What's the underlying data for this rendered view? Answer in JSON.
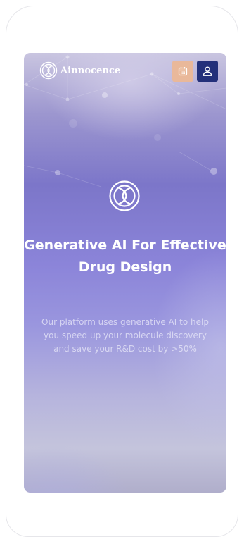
{
  "header": {
    "brand_name": "Ainnocence",
    "logo_icon": "ainnocence-logo-icon",
    "calendar_icon": "calendar-icon",
    "user_icon": "user-icon",
    "calendar_button_color": "#e9b89a",
    "user_button_color": "#23307a"
  },
  "hero": {
    "emblem_icon": "ainnocence-emblem-icon",
    "title": "Generative AI For Effective Drug Design",
    "description": "Our platform uses generative AI to help you speed up your molecule discovery and save your R&D cost by >50%",
    "gradient_colors": [
      "#c9c5e0",
      "#7c76c9",
      "#9a96de",
      "#c4c4dc"
    ]
  }
}
